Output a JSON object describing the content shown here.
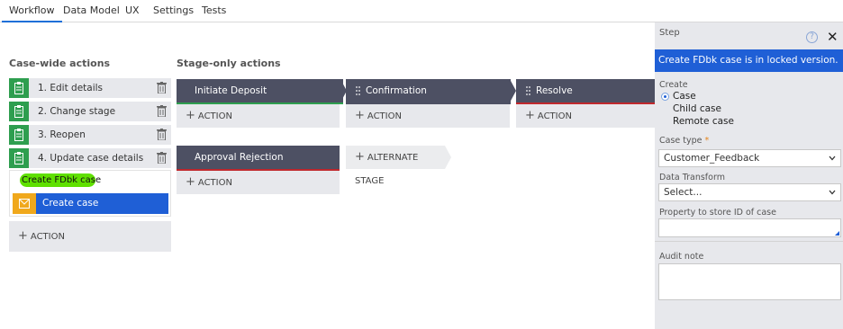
{
  "tabs": [
    "Workflow",
    "Data Model",
    "UX",
    "Settings",
    "Tests"
  ],
  "left": {
    "title": "Case-wide actions",
    "steps": [
      "1.  Edit details",
      "2.  Change stage",
      "3.  Reopen",
      "4.  Update case details"
    ],
    "highlight_text": "Create FDbk case",
    "selected_step": "Create case",
    "action_label": "ACTION"
  },
  "stages": {
    "title": "Stage-only actions",
    "items": [
      {
        "label": "Initiate Deposit",
        "line_color": "#2e9e4f"
      },
      {
        "label": "Confirmation",
        "line_color": "#4d5063"
      },
      {
        "label": "Resolve",
        "line_color": "#c0282d"
      }
    ],
    "alternate": {
      "label": "Approval Rejection",
      "line_color": "#c0282d"
    },
    "alternate_stage_label": "ALTERNATE STAGE",
    "action_label": "ACTION"
  },
  "panel": {
    "title": "Step",
    "help": "?",
    "banner": "Create FDbk case is in locked version.",
    "create_label": "Create",
    "options": [
      "Case",
      "Child case",
      "Remote case"
    ],
    "case_type_label": "Case type",
    "required_mark": "*",
    "case_type_value": "Customer_Feedback",
    "data_transform_label": "Data Transform",
    "data_transform_value": "Select...",
    "property_label": "Property to store ID of case",
    "audit_label": "Audit note"
  },
  "colors": {
    "accent": "#1f5fd6",
    "stage": "#4d5063",
    "step_icon": "#2e9e4f",
    "create_icon": "#f0a81c",
    "highlight": "#5fe000"
  }
}
